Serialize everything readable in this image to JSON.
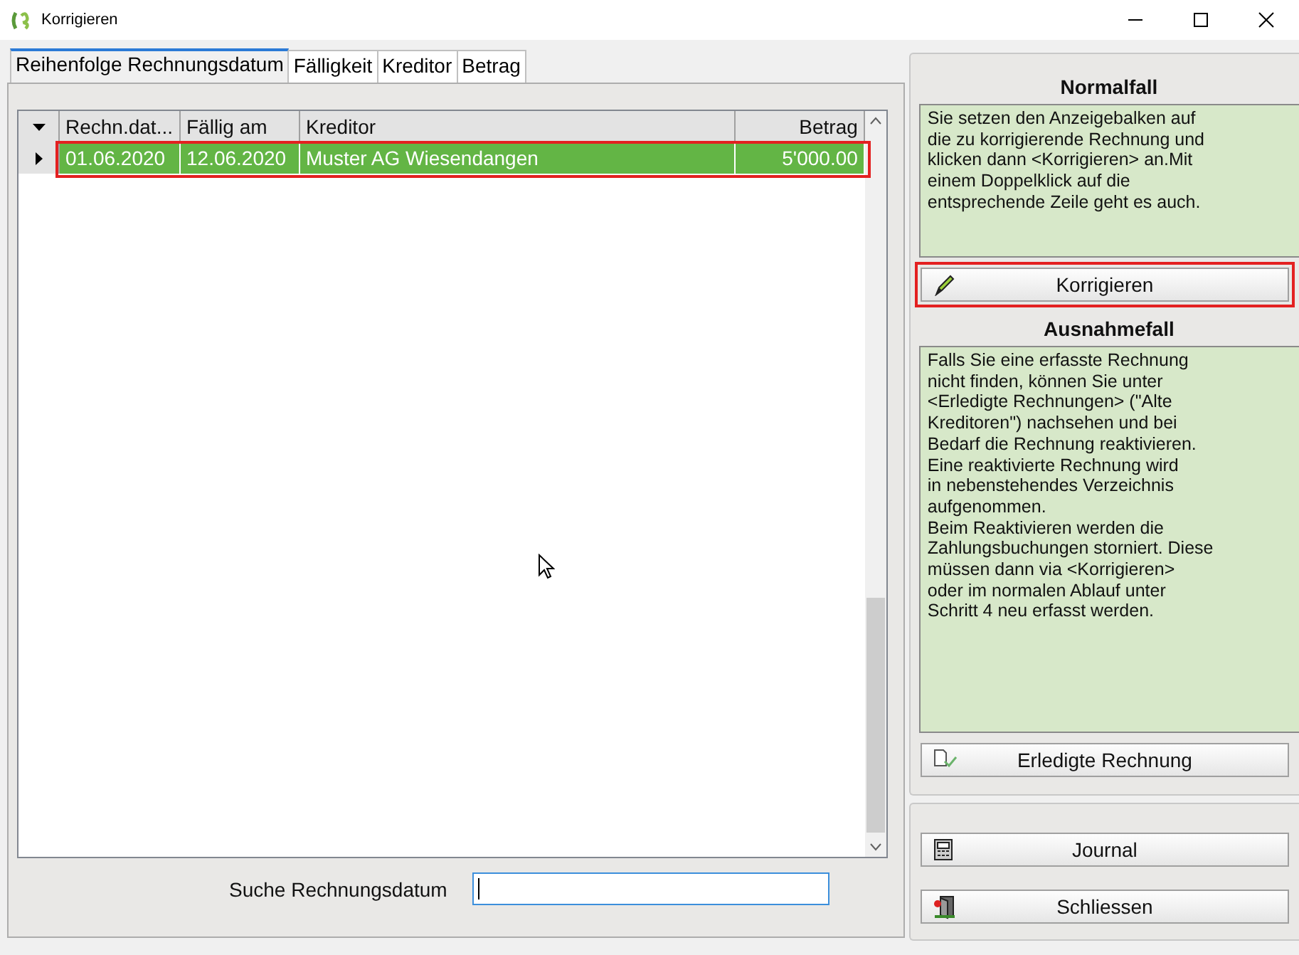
{
  "window": {
    "title": "Korrigieren"
  },
  "tabs": [
    {
      "label": "Reihenfolge Rechnungsdatum",
      "selected": true
    },
    {
      "label": "Fälligkeit",
      "selected": false
    },
    {
      "label": "Kreditor",
      "selected": false
    },
    {
      "label": "Betrag",
      "selected": false
    }
  ],
  "table": {
    "columns": [
      "Rechn.dat...",
      "Fällig am",
      "Kreditor",
      "Betrag"
    ],
    "rows": [
      {
        "cells": [
          "01.06.2020",
          "12.06.2020",
          "Muster AG Wiesendangen",
          "5'000.00"
        ],
        "selected": true,
        "current": true,
        "highlighted": true
      }
    ]
  },
  "search": {
    "label": "Suche Rechnungsdatum",
    "focused": true
  },
  "panels": [
    {
      "heading": "Normalfall",
      "text": "Sie setzen den Anzeigebalken auf\ndie zu korrigierende Rechnung und\nklicken dann <Korrigieren> an.Mit\neinem Doppelklick auf die\nentsprechende Zeile geht es auch.",
      "button": {
        "label": "Korrigieren",
        "highlighted": true
      }
    },
    {
      "heading": "Ausnahmefall",
      "text": "Falls Sie eine erfasste Rechnung\nnicht finden, können Sie unter\n<Erledigte Rechnungen> (\"Alte\nKreditoren\") nachsehen und bei\nBedarf die Rechnung reaktivieren.\nEine reaktivierte Rechnung wird\nin nebenstehendes Verzeichnis\naufgenommen.\nBeim Reaktivieren werden die\nZahlungsbuchungen storniert. Diese\nmüssen dann via <Korrigieren>\noder im normalen Ablauf unter\nSchritt 4 neu erfasst werden.",
      "button": {
        "label": "Erledigte Rechnung",
        "highlighted": false
      }
    }
  ],
  "actions": [
    {
      "label": "Journal"
    },
    {
      "label": "Schliessen"
    }
  ]
}
